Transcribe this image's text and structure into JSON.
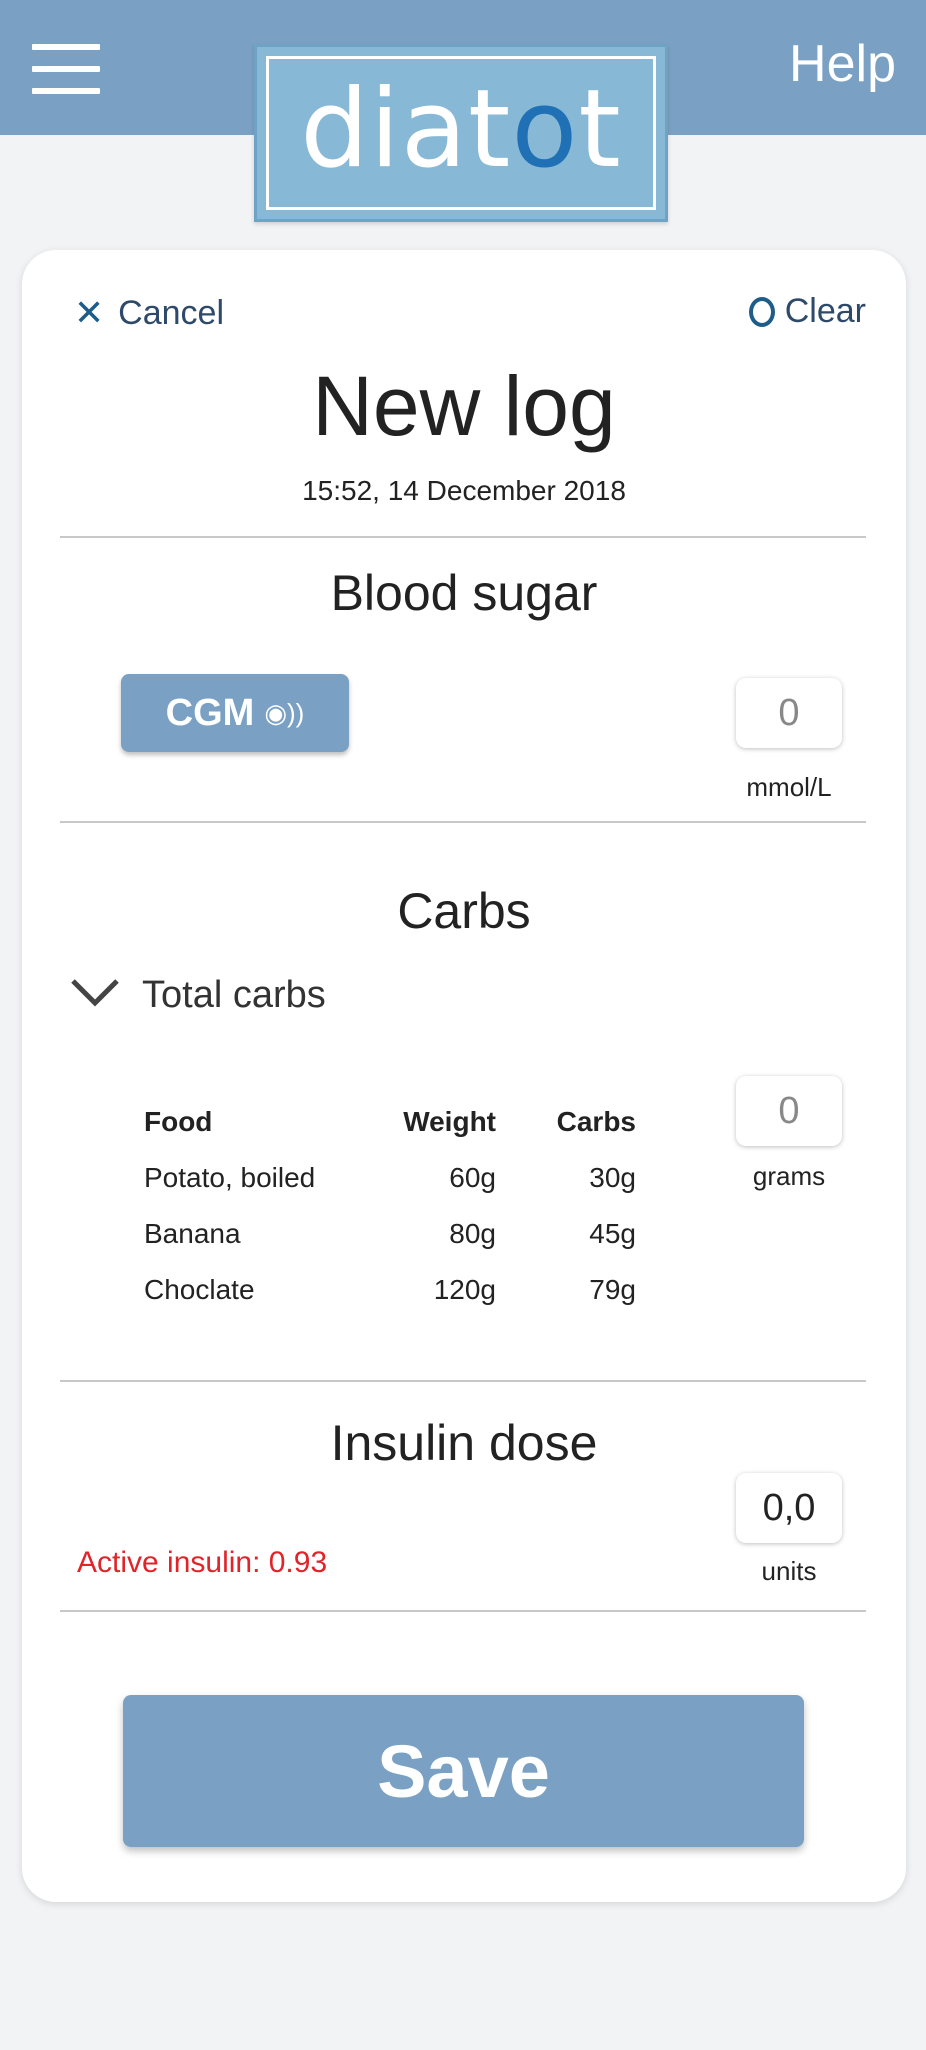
{
  "header": {
    "help_label": "Help",
    "logo_text_pre": "diat",
    "logo_text_o": "o",
    "logo_text_post": "t",
    "menu_icon": "hamburger-icon"
  },
  "form": {
    "cancel_label": "Cancel",
    "clear_label": "Clear",
    "title": "New log",
    "datetime": "15:52, 14 December 2018"
  },
  "blood_sugar": {
    "title": "Blood sugar",
    "cgm_label": "CGM",
    "cgm_icon": "nfc-icon",
    "value": "0",
    "unit": "mmol/L"
  },
  "carbs": {
    "title": "Carbs",
    "total_label": "Total carbs",
    "columns": [
      "Food",
      "Weight",
      "Carbs"
    ],
    "rows": [
      [
        "Potato, boiled",
        "60g",
        "30g"
      ],
      [
        "Banana",
        "80g",
        "45g"
      ],
      [
        "Choclate",
        "120g",
        "79g"
      ]
    ],
    "value": "0",
    "unit": "grams"
  },
  "insulin": {
    "title": "Insulin dose",
    "active_label": "Active insulin: 0.93",
    "value": "0,0",
    "unit": "units"
  },
  "save_label": "Save",
  "colors": {
    "primary": "#7aa1c3",
    "warning": "#e0242a",
    "logo_accent": "#1f70b5"
  }
}
